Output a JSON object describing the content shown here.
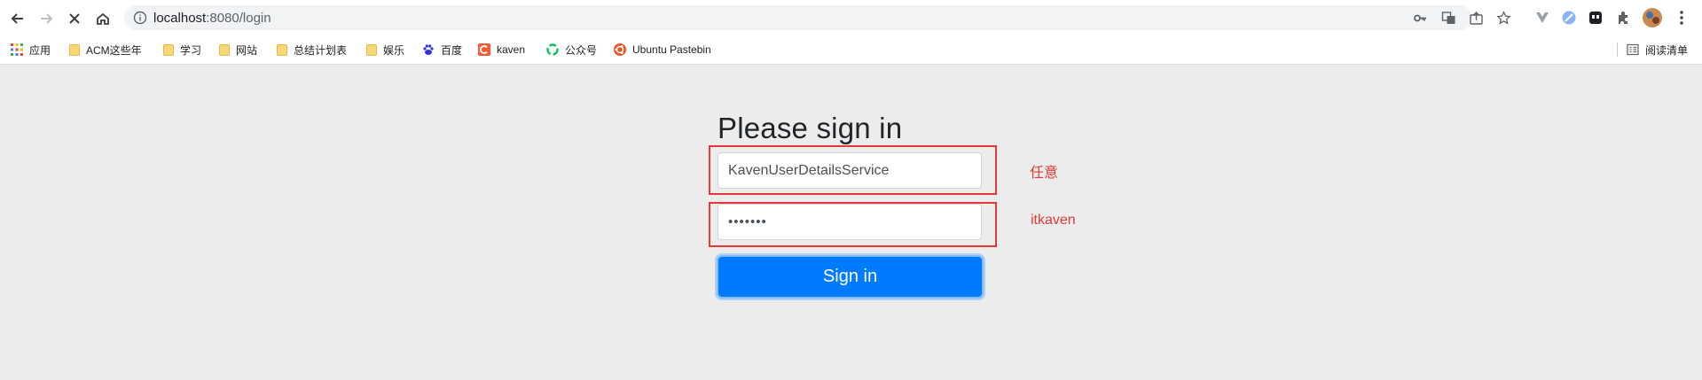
{
  "browser": {
    "url_host": "localhost",
    "url_rest": ":8080/login",
    "bookmarks": [
      {
        "label": "应用",
        "icon": "apps-grid-icon"
      },
      {
        "label": "ACM这些年",
        "icon": "folder-icon"
      },
      {
        "label": "学习",
        "icon": "folder-icon"
      },
      {
        "label": "网站",
        "icon": "folder-icon"
      },
      {
        "label": "总结计划表",
        "icon": "folder-icon"
      },
      {
        "label": "娱乐",
        "icon": "folder-icon"
      },
      {
        "label": "百度",
        "icon": "baidu-paw-icon"
      },
      {
        "label": "kaven",
        "icon": "csdn-c-icon"
      },
      {
        "label": "公众号",
        "icon": "wechat-icon"
      },
      {
        "label": "Ubuntu Pastebin",
        "icon": "ubuntu-icon"
      }
    ],
    "reading_list_label": "阅读清单"
  },
  "login": {
    "heading": "Please sign in",
    "username_value": "KavenUserDetailsService",
    "password_value": "•••••••",
    "submit_label": "Sign in"
  },
  "annotations": {
    "username_note": "任意",
    "password_note": "itkaven"
  },
  "colors": {
    "page_background": "#ececec",
    "primary_button": "#007bff",
    "annotation_red": "#e53935"
  }
}
